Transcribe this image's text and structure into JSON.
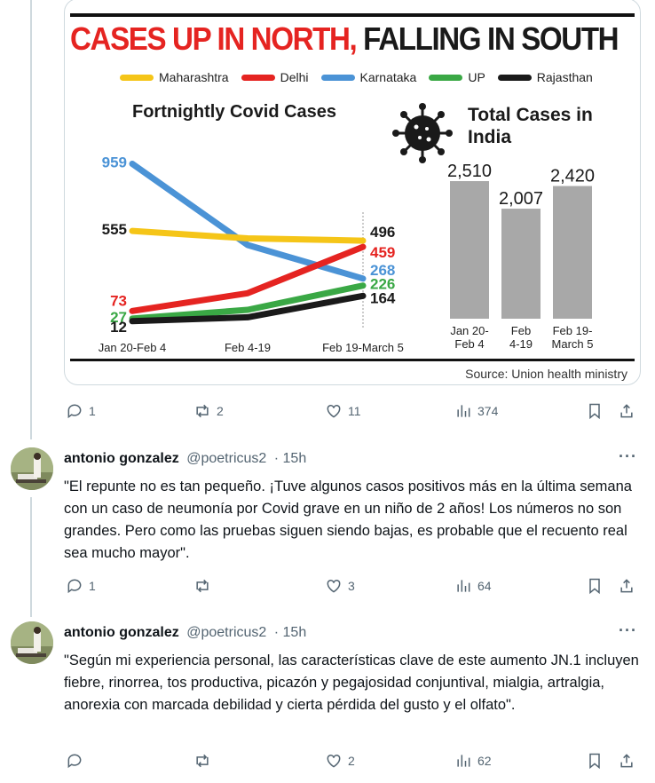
{
  "infographic": {
    "headline_red": "CASES UP IN NORTH,",
    "headline_black": " FALLING IN SOUTH",
    "legend": [
      {
        "name": "Maharashtra",
        "color": "#f5c518"
      },
      {
        "name": "Delhi",
        "color": "#e52421"
      },
      {
        "name": "Karnataka",
        "color": "#4b93d6"
      },
      {
        "name": "UP",
        "color": "#3aa845"
      },
      {
        "name": "Rajasthan",
        "color": "#1a1a1a"
      }
    ],
    "line_title": "Fortnightly Covid Cases",
    "bar_title": "Total Cases in India",
    "source": "Source: Union health ministry"
  },
  "chart_data": [
    {
      "type": "line",
      "title": "Fortnightly Covid Cases",
      "categories": [
        "Jan 20-Feb 4",
        "Feb 4-19",
        "Feb 19-March 5"
      ],
      "series": [
        {
          "name": "Maharashtra",
          "color": "#f5c518",
          "values": [
            555,
            510,
            496
          ]
        },
        {
          "name": "Delhi",
          "color": "#e52421",
          "values": [
            73,
            180,
            459
          ]
        },
        {
          "name": "Karnataka",
          "color": "#4b93d6",
          "values": [
            959,
            470,
            268
          ]
        },
        {
          "name": "UP",
          "color": "#3aa845",
          "values": [
            27,
            80,
            226
          ]
        },
        {
          "name": "Rajasthan",
          "color": "#1a1a1a",
          "values": [
            12,
            35,
            164
          ]
        }
      ],
      "start_labels": [
        "555",
        "73",
        "959",
        "27",
        "12"
      ],
      "end_labels": [
        "496",
        "459",
        "268",
        "226",
        "164"
      ]
    },
    {
      "type": "bar",
      "title": "Total Cases in India",
      "categories": [
        "Jan 20-Feb 4",
        "Feb 4-19",
        "Feb 19-March 5"
      ],
      "category_lines": [
        [
          "Jan 20-",
          "Feb 4"
        ],
        [
          "Feb",
          "4-19"
        ],
        [
          "Feb 19-",
          "March 5"
        ]
      ],
      "values": [
        2510,
        2007,
        2420
      ],
      "value_labels": [
        "2,510",
        "2,007",
        "2,420"
      ],
      "color": "#a8a8a8"
    }
  ],
  "tweet_actions": {
    "replies": "1",
    "reposts": "2",
    "likes": "11",
    "views": "374"
  },
  "replies": [
    {
      "name": "antonio gonzalez",
      "handle": "@poetricus2",
      "time": "· 15h",
      "text": "\"El repunte no es tan pequeño. ¡Tuve algunos casos positivos más en la última semana con un caso de neumonía por Covid grave en un niño de 2 años! Los números no son grandes. Pero como las pruebas siguen siendo bajas, es probable que el recuento real sea mucho mayor\".",
      "actions": {
        "replies": "1",
        "reposts": "",
        "likes": "3",
        "views": "64"
      }
    },
    {
      "name": "antonio gonzalez",
      "handle": "@poetricus2",
      "time": "· 15h",
      "text": "\"Según mi experiencia personal, las características clave de este aumento JN.1 incluyen fiebre, rinorrea, tos productiva, picazón y pegajosidad conjuntival, mialgia, artralgia, anorexia con marcada debilidad y cierta pérdida del gusto y el olfato\".",
      "actions": {
        "replies": "",
        "reposts": "",
        "likes": "2",
        "views": "62"
      }
    }
  ],
  "icons": {
    "reply": "reply-icon",
    "repost": "repost-icon",
    "like": "like-icon",
    "views": "views-icon",
    "bookmark": "bookmark-icon",
    "share": "share-icon",
    "more": "more-icon"
  }
}
